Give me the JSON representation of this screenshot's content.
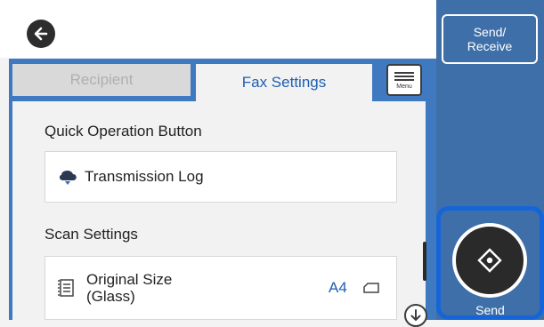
{
  "tabs": {
    "recipient": "Recipient",
    "fax_settings": "Fax Settings"
  },
  "menu": {
    "label": "Menu"
  },
  "sections": {
    "quick_operation": "Quick Operation Button",
    "scan_settings": "Scan Settings"
  },
  "items": {
    "transmission_log": "Transmission Log",
    "original_size": {
      "line1": "Original Size",
      "line2": "(Glass)",
      "value": "A4"
    }
  },
  "right_panel": {
    "send_receive": "Send/\nReceive",
    "send": "Send"
  },
  "colors": {
    "frame_blue": "#3f79bf",
    "panel_blue": "#3f6fa8",
    "tab_text_blue": "#1e5fb0",
    "highlight_blue": "#1565d8"
  }
}
